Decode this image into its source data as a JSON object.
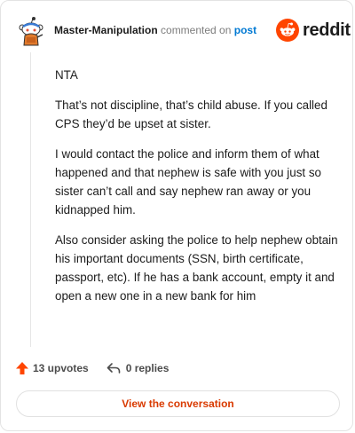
{
  "header": {
    "username": "Master-Manipulation",
    "commented_text": "commented on",
    "post_link": "post",
    "brand": "reddit"
  },
  "comment": {
    "paragraphs": [
      "NTA",
      "That’s not discipline, that’s child abuse. If you called CPS they’d be upset at sister.",
      "I would contact the police and inform them of what happened and that nephew is safe with you just so sister can’t call and say nephew ran away or you kidnapped him.",
      "Also consider asking the police to help nephew obtain his important documents (SSN, birth certificate, passport, etc). If he has a bank account, empty it and open a new one in a new bank for him"
    ]
  },
  "actions": {
    "upvotes": "13 upvotes",
    "replies": "0 replies"
  },
  "view_button": "View the conversation",
  "colors": {
    "brand_orange": "#ff4500",
    "link_blue": "#0079d3",
    "button_text": "#d93a00",
    "upvote_icon": "#ff4500"
  },
  "icons": {
    "avatar": "snoo-avatar-icon",
    "logo": "reddit-logo-icon",
    "upvote": "upvote-arrow-icon",
    "reply": "reply-arrow-icon"
  }
}
